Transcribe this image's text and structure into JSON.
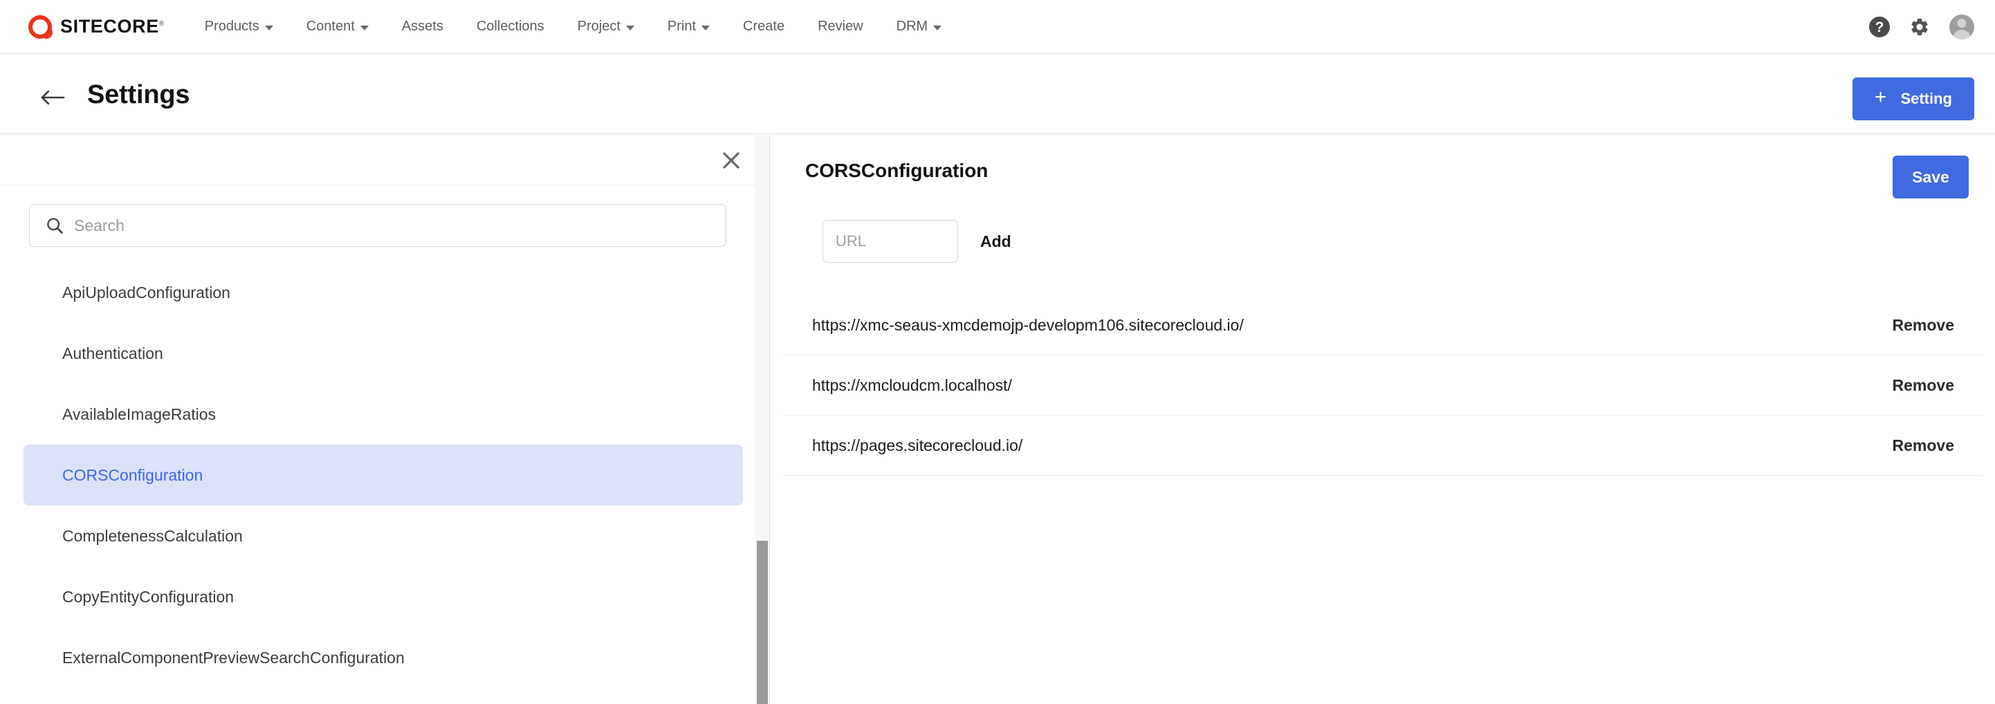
{
  "brand": {
    "name": "SITECORE",
    "trademark": "®",
    "logo_color": "#e8341c"
  },
  "topnav": {
    "items": [
      {
        "label": "Products",
        "has_caret": true
      },
      {
        "label": "Content",
        "has_caret": true
      },
      {
        "label": "Assets",
        "has_caret": false
      },
      {
        "label": "Collections",
        "has_caret": false
      },
      {
        "label": "Project",
        "has_caret": true
      },
      {
        "label": "Print",
        "has_caret": true
      },
      {
        "label": "Create",
        "has_caret": false
      },
      {
        "label": "Review",
        "has_caret": false
      },
      {
        "label": "DRM",
        "has_caret": true
      }
    ],
    "right_icons": [
      {
        "name": "help-icon",
        "glyph": "?"
      },
      {
        "name": "gear-icon",
        "glyph": "⚙"
      },
      {
        "name": "avatar",
        "glyph": ""
      }
    ]
  },
  "page_header": {
    "back_icon": "arrow-left-icon",
    "title": "Settings",
    "primary_button": {
      "label": "Setting",
      "icon": "plus-icon",
      "color": "#3f6ae0"
    }
  },
  "left_panel": {
    "close_icon": "close-icon",
    "search": {
      "icon": "search-icon",
      "placeholder": "Search",
      "value": ""
    },
    "items": [
      {
        "label": "ApiUploadConfiguration",
        "selected": false
      },
      {
        "label": "Authentication",
        "selected": false
      },
      {
        "label": "AvailableImageRatios",
        "selected": false
      },
      {
        "label": "CORSConfiguration",
        "selected": true
      },
      {
        "label": "CompletenessCalculation",
        "selected": false
      },
      {
        "label": "CopyEntityConfiguration",
        "selected": false
      },
      {
        "label": "ExternalComponentPreviewSearchConfiguration",
        "selected": false
      }
    ],
    "selected_color": "#3b68e8",
    "selected_bg": "#dbe2f9"
  },
  "right_panel": {
    "title": "CORSConfiguration",
    "save_label": "Save",
    "save_color": "#3f6ae0",
    "url_input": {
      "placeholder": "URL",
      "value": ""
    },
    "add_label": "Add",
    "remove_label": "Remove",
    "urls": [
      {
        "url": "https://xmc-seaus-xmcdemojp-developm106.sitecorecloud.io/",
        "action": "Remove"
      },
      {
        "url": "https://xmcloudcm.localhost/",
        "action": "Remove"
      },
      {
        "url": "https://pages.sitecorecloud.io/",
        "action": "Remove"
      }
    ]
  }
}
